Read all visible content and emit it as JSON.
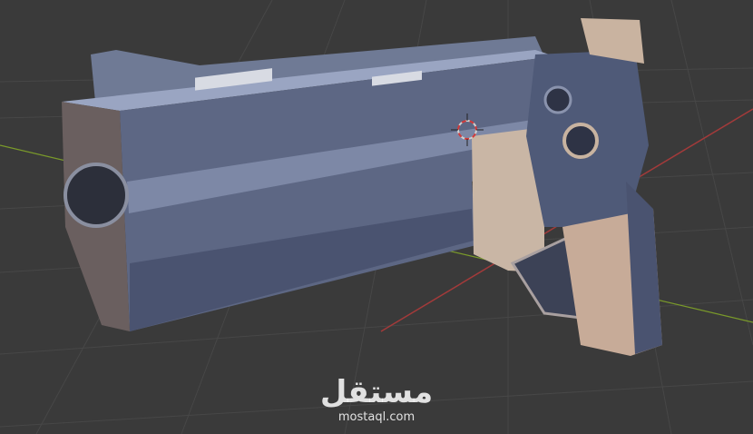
{
  "viewport": {
    "background": "#3a3a3a",
    "grid_color": "#464646",
    "x_axis_color": "#a33a3a",
    "y_axis_color": "#7a9a2a"
  },
  "watermark": {
    "arabic": "مستقل",
    "domain": "mostaql.com"
  }
}
